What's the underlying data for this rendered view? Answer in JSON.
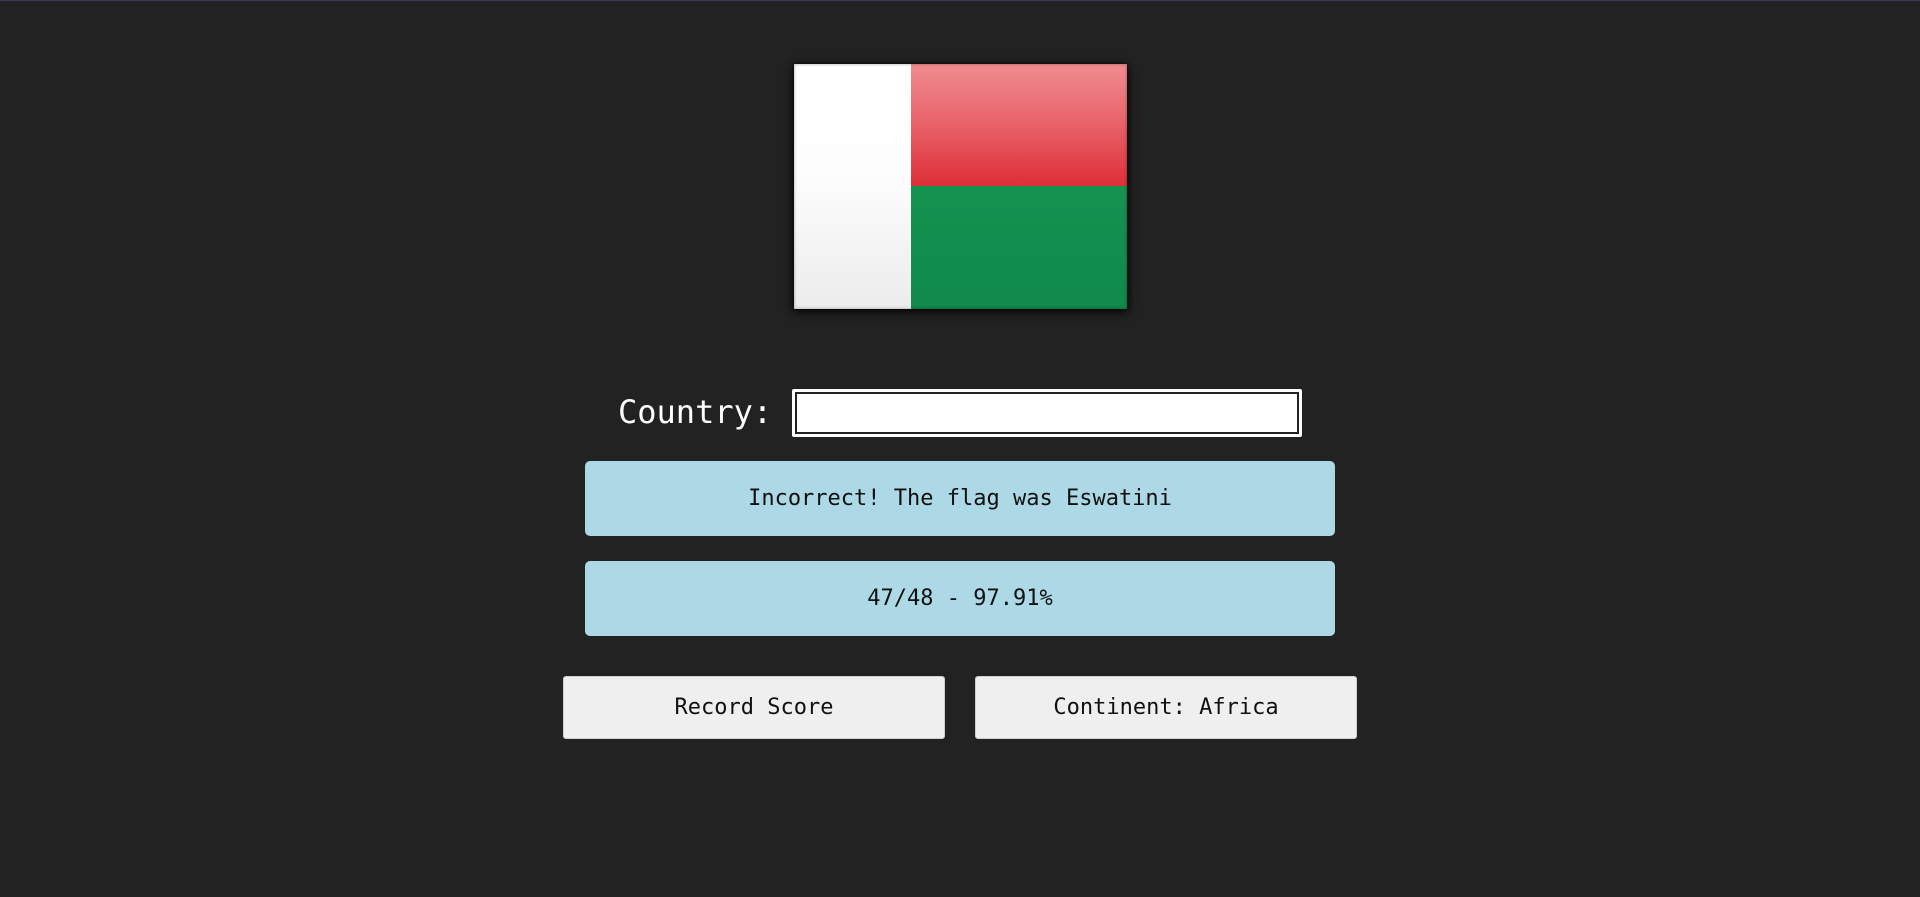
{
  "flag": {
    "country_shown": "Madagascar",
    "colors": {
      "hoist": "#ffffff",
      "top": "#e23b44",
      "bottom": "#0f8a4b"
    }
  },
  "form": {
    "label": "Country:",
    "input_value": "",
    "placeholder": ""
  },
  "feedback": {
    "text": "Incorrect! The flag was Eswatini"
  },
  "score": {
    "text": "47/48 - 97.91%"
  },
  "buttons": {
    "record_label": "Record Score",
    "continent_label": "Continent: Africa"
  },
  "colors": {
    "background": "#222222",
    "info_box": "#add8e6",
    "button": "#efefef"
  }
}
